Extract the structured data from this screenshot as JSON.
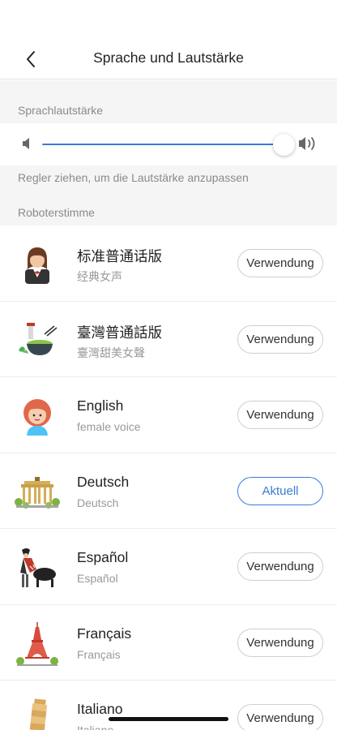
{
  "header": {
    "title": "Sprache und Lautstärke"
  },
  "volume": {
    "section_label": "Sprachlautstärke",
    "level": 1.0,
    "hint": "Regler ziehen, um die Lautstärke anzupassen"
  },
  "voices": {
    "section_label": "Roboterstimme",
    "items": [
      {
        "name": "标准普通话版",
        "sub": "经典女声",
        "button": "Verwendung",
        "icon": "woman-avatar-icon",
        "active": false
      },
      {
        "name": "臺灣普通話版",
        "sub": "臺灣甜美女聲",
        "button": "Verwendung",
        "icon": "taiwan-food-icon",
        "active": false
      },
      {
        "name": "English",
        "sub": "female voice",
        "button": "Verwendung",
        "icon": "girl-avatar-icon",
        "active": false
      },
      {
        "name": "Deutsch",
        "sub": "Deutsch",
        "button": "Aktuell",
        "icon": "brandenburg-gate-icon",
        "active": true
      },
      {
        "name": "Español",
        "sub": "Español",
        "button": "Verwendung",
        "icon": "matador-bull-icon",
        "active": false
      },
      {
        "name": "Français",
        "sub": "Français",
        "button": "Verwendung",
        "icon": "eiffel-tower-icon",
        "active": false
      },
      {
        "name": "Italiano",
        "sub": "Italiano",
        "button": "Verwendung",
        "icon": "pisa-tower-icon",
        "active": false
      }
    ]
  },
  "colors": {
    "accent": "#3a7bd5",
    "section_bg": "#f5f5f5"
  }
}
